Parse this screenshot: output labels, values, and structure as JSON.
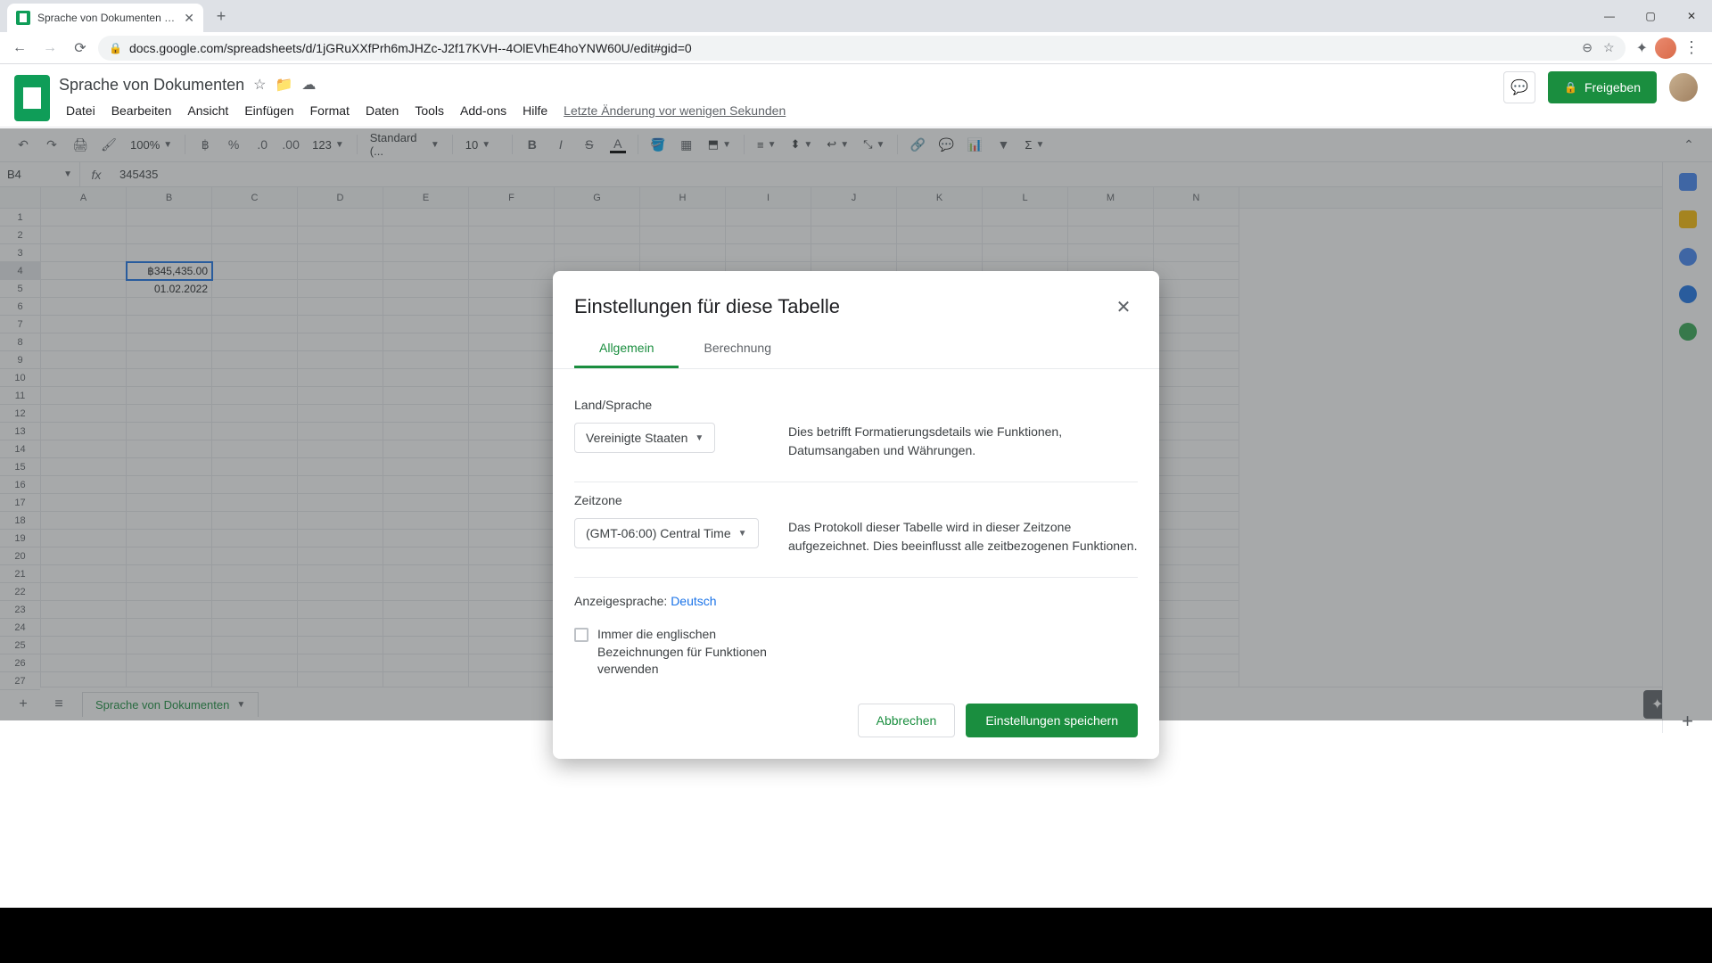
{
  "browser": {
    "tab_title": "Sprache von Dokumenten - Goo",
    "url": "docs.google.com/spreadsheets/d/1jGRuXXfPrh6mJHZc-J2f17KVH--4OlEVhE4hoYNW60U/edit#gid=0"
  },
  "doc": {
    "title": "Sprache von Dokumenten",
    "last_edit": "Letzte Änderung vor wenigen Sekunden",
    "share_label": "Freigeben"
  },
  "menubar": [
    "Datei",
    "Bearbeiten",
    "Ansicht",
    "Einfügen",
    "Format",
    "Daten",
    "Tools",
    "Add-ons",
    "Hilfe"
  ],
  "toolbar": {
    "zoom": "100%",
    "num_format": ".0",
    "num_format2": ".00",
    "number_style": "123",
    "font_family": "Standard (...",
    "font_size": "10"
  },
  "formula": {
    "cell_ref": "B4",
    "value": "345435"
  },
  "columns": [
    "A",
    "B",
    "C",
    "D",
    "E",
    "F",
    "G",
    "H",
    "I",
    "J",
    "K",
    "L",
    "M",
    "N"
  ],
  "cells": {
    "b4": "฿345,435.00",
    "b5": "01.02.2022"
  },
  "sheet_tab": "Sprache von Dokumenten",
  "modal": {
    "title": "Einstellungen für diese Tabelle",
    "tabs": {
      "general": "Allgemein",
      "calc": "Berechnung"
    },
    "locale": {
      "label": "Land/Sprache",
      "value": "Vereinigte Staaten",
      "desc": "Dies betrifft Formatierungsdetails wie Funktionen, Datumsangaben und Währungen."
    },
    "timezone": {
      "label": "Zeitzone",
      "value": "(GMT-06:00) Central Time",
      "desc": "Das Protokoll dieser Tabelle wird in dieser Zeitzone aufgezeichnet. Dies beeinflusst alle zeitbezogenen Funktionen."
    },
    "display_lang": {
      "prefix": "Anzeigesprache: ",
      "lang": "Deutsch"
    },
    "checkbox_label": "Immer die englischen Bezeichnungen für Funktionen verwenden",
    "cancel": "Abbrechen",
    "save": "Einstellungen speichern"
  }
}
